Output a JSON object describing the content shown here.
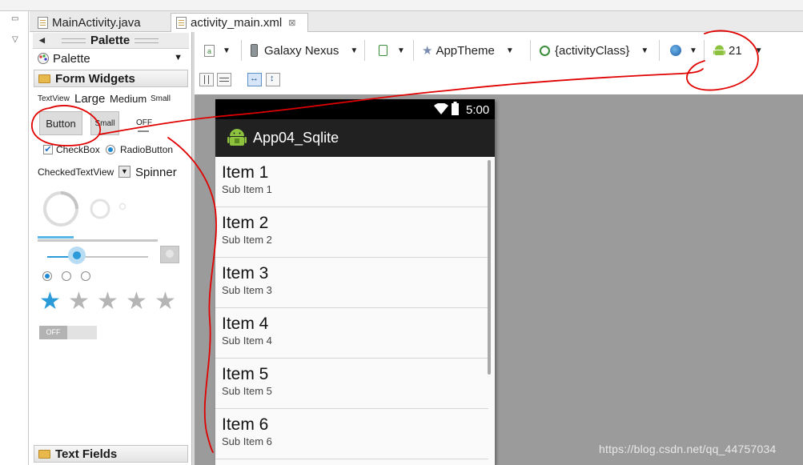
{
  "colors": {
    "ide_bg": "#ffffff",
    "canvas_bg": "#9b9b9b",
    "status_bar": "#000000",
    "action_bar": "#212121",
    "accent_blue": "#2a9ad8",
    "annotation_red": "#e00000",
    "android_green": "#8dc23e"
  },
  "tabs": [
    {
      "label": "MainActivity.java",
      "icon": "java-file-icon",
      "active": false
    },
    {
      "label": "activity_main.xml",
      "icon": "xml-file-icon",
      "active": true,
      "close": "⊠"
    }
  ],
  "palette": {
    "header": "Palette",
    "selector": "Palette",
    "sections": {
      "form_widgets": "Form Widgets",
      "text_fields": "Text Fields"
    },
    "textview_sizes": {
      "textview": "TextView",
      "large": "Large",
      "medium": "Medium",
      "small": "Small"
    },
    "buttons": {
      "button": "Button",
      "small": "Small",
      "toggle": "OFF"
    },
    "checkbox": "CheckBox",
    "radiobutton": "RadioButton",
    "checkedtextview": "CheckedTextView",
    "spinner": "Spinner",
    "switch_off": "OFF",
    "rating_stars": 1,
    "rating_max": 5,
    "seek_level": 0.3,
    "progress_level": 0.3
  },
  "toolbar": {
    "device": "Galaxy Nexus",
    "theme": "AppTheme",
    "activity": "{activityClass}",
    "api": "21"
  },
  "device": {
    "time": "5:00",
    "app_title": "App04_Sqlite",
    "items": [
      {
        "title": "Item 1",
        "subtitle": "Sub Item 1"
      },
      {
        "title": "Item 2",
        "subtitle": "Sub Item 2"
      },
      {
        "title": "Item 3",
        "subtitle": "Sub Item 3"
      },
      {
        "title": "Item 4",
        "subtitle": "Sub Item 4"
      },
      {
        "title": "Item 5",
        "subtitle": "Sub Item 5"
      },
      {
        "title": "Item 6",
        "subtitle": "Sub Item 6"
      }
    ]
  },
  "watermark": "https://blog.csdn.net/qq_44757034"
}
